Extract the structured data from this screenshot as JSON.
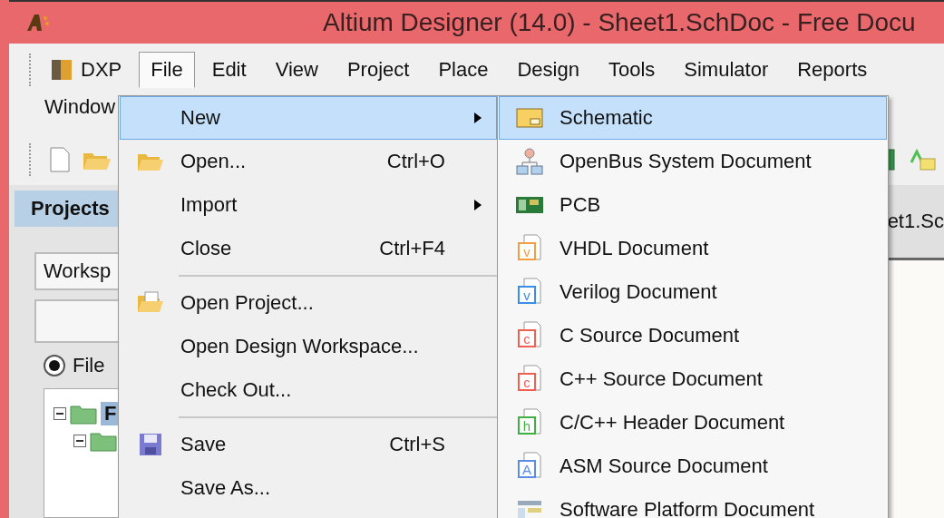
{
  "window": {
    "title": "Altium Designer (14.0) - Sheet1.SchDoc - Free Docu"
  },
  "menu_bar": {
    "app_menu": {
      "label": "DXP"
    },
    "items": [
      {
        "label": "File",
        "selected": true
      },
      {
        "label": "Edit",
        "selected": false
      },
      {
        "label": "View",
        "selected": false
      },
      {
        "label": "Project",
        "selected": false
      },
      {
        "label": "Place",
        "selected": false
      },
      {
        "label": "Design",
        "selected": false
      },
      {
        "label": "Tools",
        "selected": false
      },
      {
        "label": "Simulator",
        "selected": false
      },
      {
        "label": "Reports",
        "selected": false
      },
      {
        "label": "Window",
        "selected": false
      }
    ]
  },
  "projects_panel": {
    "title": "Projects",
    "workspace_field": {
      "value": "Worksp"
    },
    "radio": {
      "label": "File",
      "selected": true
    },
    "tree": [
      {
        "label": "F",
        "selected": true,
        "expanded": true,
        "children": [
          {
            "expanded": true
          }
        ]
      }
    ]
  },
  "document_tab": {
    "label": "et1.Sc"
  },
  "file_menu": [
    {
      "kind": "item",
      "label": "New",
      "submenu": true,
      "selected": true
    },
    {
      "kind": "item",
      "label": "Open...",
      "shortcut": "Ctrl+O",
      "selected": false
    },
    {
      "kind": "item",
      "label": "Import",
      "submenu": true,
      "selected": false
    },
    {
      "kind": "item",
      "label": "Close",
      "shortcut": "Ctrl+F4",
      "selected": false
    },
    {
      "kind": "separator"
    },
    {
      "kind": "item",
      "label": "Open Project...",
      "selected": false
    },
    {
      "kind": "item",
      "label": "Open Design Workspace...",
      "selected": false
    },
    {
      "kind": "item",
      "label": "Check Out...",
      "selected": false
    },
    {
      "kind": "separator"
    },
    {
      "kind": "item",
      "label": "Save",
      "shortcut": "Ctrl+S",
      "selected": false
    },
    {
      "kind": "item",
      "label": "Save As...",
      "selected": false
    }
  ],
  "new_submenu": [
    {
      "label": "Schematic",
      "selected": true
    },
    {
      "label": "OpenBus System Document",
      "selected": false
    },
    {
      "label": "PCB",
      "selected": false
    },
    {
      "label": "VHDL Document",
      "icon_text": "v",
      "selected": false
    },
    {
      "label": "Verilog Document",
      "icon_text": "v",
      "selected": false
    },
    {
      "label": "C Source Document",
      "icon_text": "c",
      "selected": false
    },
    {
      "label": "C++ Source Document",
      "icon_text": "c",
      "selected": false
    },
    {
      "label": "C/C++ Header Document",
      "icon_text": "h",
      "selected": false
    },
    {
      "label": "ASM Source Document",
      "icon_text": "A",
      "selected": false
    },
    {
      "label": "Software Platform Document",
      "selected": false
    }
  ]
}
